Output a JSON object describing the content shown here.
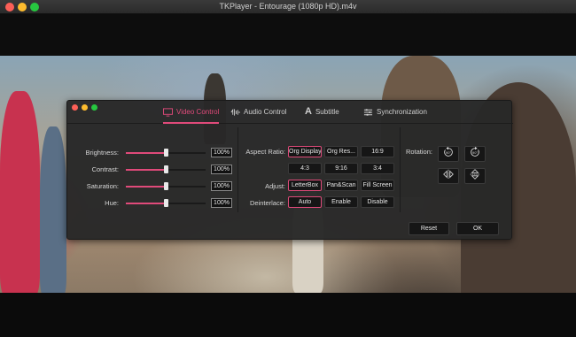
{
  "window": {
    "title": "TKPlayer - Entourage (1080p HD).m4v"
  },
  "tabs": [
    {
      "label": "Video Control",
      "icon": "monitor-icon"
    },
    {
      "label": "Audio Control",
      "icon": "audio-wave-icon"
    },
    {
      "label": "Subtitle",
      "icon": "letter-a-icon"
    },
    {
      "label": "Synchronization",
      "icon": "sliders-icon"
    }
  ],
  "sliders": [
    {
      "label": "Brightness:",
      "value": "100%",
      "level": 0.5
    },
    {
      "label": "Contrast:",
      "value": "100%",
      "level": 0.5
    },
    {
      "label": "Saturation:",
      "value": "100%",
      "level": 0.5
    },
    {
      "label": "Hue:",
      "value": "100%",
      "level": 0.5
    }
  ],
  "aspect_ratio": {
    "label": "Aspect Ratio:",
    "options": [
      "Org Display",
      "Org Res...",
      "16:9",
      "4:3",
      "9:16",
      "3:4"
    ],
    "selected": "Org Display"
  },
  "adjust": {
    "label": "Adjust:",
    "options": [
      "LetterBox",
      "Pan&Scan",
      "Fill Screen"
    ],
    "selected": "LetterBox"
  },
  "deinterlace": {
    "label": "Deinterlace:",
    "options": [
      "Auto",
      "Enable",
      "Disable"
    ],
    "selected": "Auto"
  },
  "rotation": {
    "label": "Rotation:",
    "buttons": [
      {
        "name": "rotate-left-90",
        "text": "90°"
      },
      {
        "name": "rotate-right-90",
        "text": "90°"
      }
    ]
  },
  "actions": {
    "reset": "Reset",
    "ok": "OK"
  },
  "colors": {
    "accent": "#e04a7a",
    "panel": "#282828"
  }
}
